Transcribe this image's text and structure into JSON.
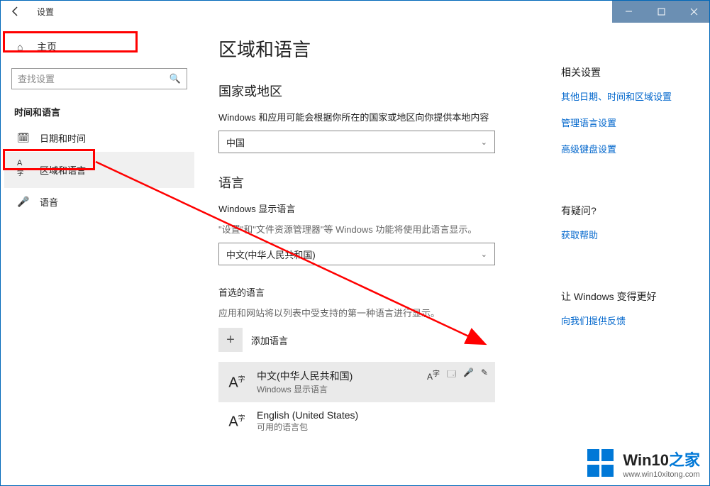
{
  "window": {
    "title": "设置"
  },
  "sidebar": {
    "home": "主页",
    "search_placeholder": "查找设置",
    "section": "时间和语言",
    "items": [
      {
        "icon": "🗓",
        "label": "日期和时间"
      },
      {
        "icon": "A字",
        "label": "区域和语言"
      },
      {
        "icon": "🎤",
        "label": "语音"
      }
    ]
  },
  "main": {
    "title": "区域和语言",
    "region": {
      "heading": "国家或地区",
      "desc": "Windows 和应用可能会根据你所在的国家或地区向你提供本地内容",
      "selected": "中国"
    },
    "language": {
      "heading": "语言",
      "display_label": "Windows 显示语言",
      "display_desc": "\"设置\"和\"文件资源管理器\"等 Windows 功能将使用此语言显示。",
      "display_selected": "中文(中华人民共和国)",
      "preferred_label": "首选的语言",
      "preferred_desc": "应用和网站将以列表中受支持的第一种语言进行显示。",
      "add_label": "添加语言",
      "items": [
        {
          "name": "中文(中华人民共和国)",
          "sub": "Windows 显示语言",
          "selected": true
        },
        {
          "name": "English (United States)",
          "sub": "可用的语言包",
          "selected": false
        }
      ]
    }
  },
  "right": {
    "related_head": "相关设置",
    "links1": [
      "其他日期、时间和区域设置",
      "管理语言设置",
      "高级键盘设置"
    ],
    "question_head": "有疑问?",
    "help_link": "获取帮助",
    "better_head": "让 Windows 变得更好",
    "feedback_link": "向我们提供反馈"
  },
  "watermark": {
    "brand_en": "Win10",
    "brand_zh": "之家",
    "url": "www.win10xitong.com"
  }
}
